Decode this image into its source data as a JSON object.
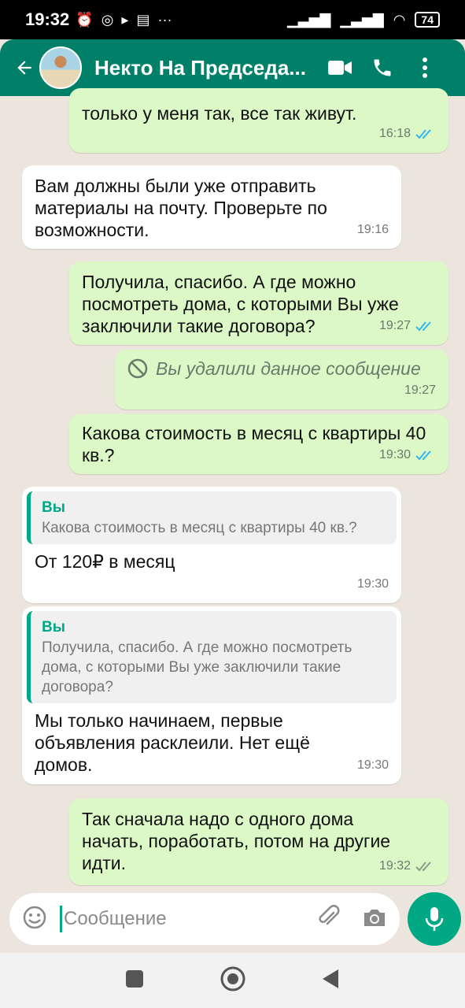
{
  "status_bar": {
    "time": "19:32",
    "battery": "74",
    "left_icons": [
      "alarm-icon",
      "viber-icon",
      "play-icon",
      "calendar-icon",
      "more-dots-icon"
    ],
    "right_icons": [
      "signal-icon",
      "signal-icon",
      "wifi-icon",
      "battery-icon"
    ]
  },
  "header": {
    "contact_name": "Некто На Председа...",
    "icons": [
      "back-arrow-icon",
      "video-call-icon",
      "phone-icon",
      "more-vert-icon"
    ],
    "color": "#008069"
  },
  "messages": [
    {
      "dir": "out",
      "text": "только у меня так, все так живут.",
      "time": "16:18",
      "status": "read"
    },
    {
      "dir": "in",
      "text": "Вам должны были уже отправить материалы на почту. Проверьте по возможности.",
      "time": "19:16"
    },
    {
      "dir": "out",
      "text": "Получила, спасибо. А где можно посмотреть дома, с которыми Вы уже заключили такие договора?",
      "time": "19:27",
      "status": "read"
    },
    {
      "dir": "out",
      "text": "Вы удалили данное сообщение",
      "time": "19:27",
      "deleted": true
    },
    {
      "dir": "out",
      "text": "Какова стоимость в месяц с квартиры 40 кв.?",
      "time": "19:30",
      "status": "read"
    },
    {
      "dir": "in",
      "quote_name": "Вы",
      "quote_text": "Какова стоимость в месяц с квартиры 40 кв.?",
      "text": "От 120₽ в месяц",
      "time": "19:30"
    },
    {
      "dir": "in",
      "quote_name": "Вы",
      "quote_text": "Получила, спасибо. А где можно посмотреть дома, с которыми Вы уже заключили такие договора?",
      "text": "Мы только начинаем, первые объявления расклеили. Нет ещё домов.",
      "time": "19:30"
    },
    {
      "dir": "out",
      "text": "Так сначала надо с одного дома начать, поработать, потом на другие идти.",
      "time": "19:32",
      "status": "delivered"
    }
  ],
  "input": {
    "placeholder": "Сообщение"
  },
  "colors": {
    "outgoing": "#dcf8c6",
    "incoming": "#ffffff",
    "accent": "#00a884",
    "read_tick": "#34b7f1",
    "delivered_tick": "#8a9a8a"
  }
}
